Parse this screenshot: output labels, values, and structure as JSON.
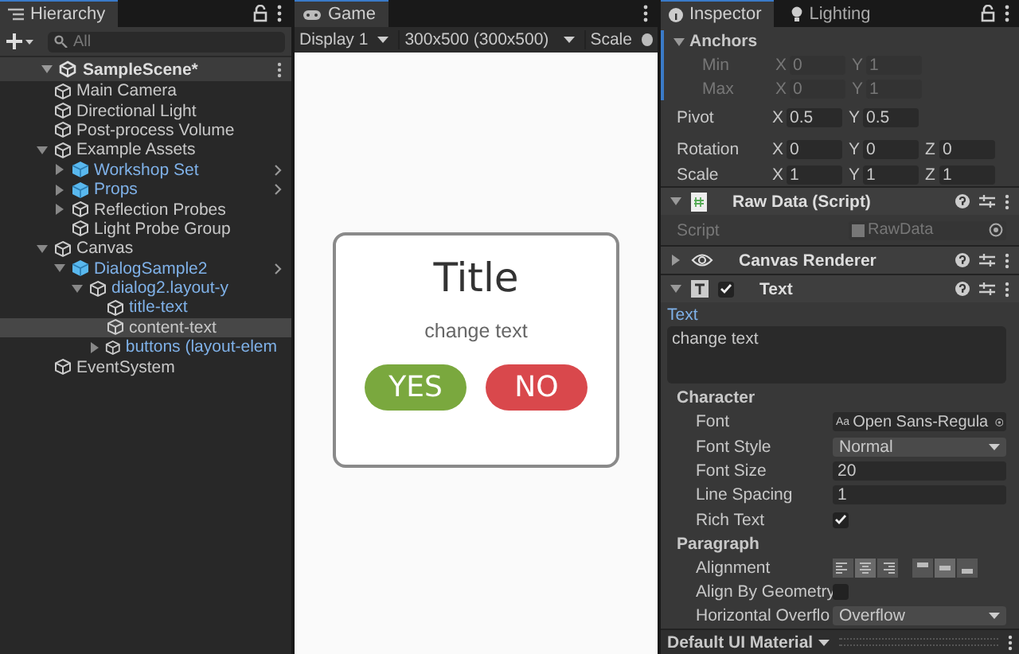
{
  "hierarchy": {
    "title": "Hierarchy",
    "search_placeholder": "All",
    "scene": {
      "name": "SampleScene*",
      "expanded": true
    },
    "items": [
      {
        "name": "Main Camera",
        "kind": "object",
        "selected": false
      },
      {
        "name": "Directional Light",
        "kind": "object",
        "selected": false
      },
      {
        "name": "Post-process Volume",
        "kind": "object",
        "selected": false
      },
      {
        "name": "Example Assets",
        "kind": "object",
        "selected": false,
        "expanded": true,
        "children": [
          {
            "name": "Workshop Set",
            "kind": "prefab",
            "selected": false,
            "expanded": false
          },
          {
            "name": "Props",
            "kind": "prefab",
            "selected": false,
            "expanded": false
          },
          {
            "name": "Reflection Probes",
            "kind": "object",
            "selected": false,
            "expanded": false
          },
          {
            "name": "Light Probe Group",
            "kind": "object",
            "selected": false
          }
        ]
      },
      {
        "name": "Canvas",
        "kind": "object",
        "selected": false,
        "expanded": true,
        "children": [
          {
            "name": "DialogSample2",
            "kind": "prefab",
            "selected": false,
            "expanded": true,
            "children": [
              {
                "name": "dialog2.layout-y",
                "kind": "prefab-child",
                "selected": false,
                "expanded": true,
                "children": [
                  {
                    "name": "title-text",
                    "kind": "prefab-child",
                    "selected": false
                  },
                  {
                    "name": "content-text",
                    "kind": "object",
                    "selected": true
                  },
                  {
                    "name": "buttons (layout-elem",
                    "kind": "prefab-child",
                    "selected": false,
                    "expanded": false
                  }
                ]
              }
            ]
          }
        ]
      },
      {
        "name": "EventSystem",
        "kind": "object",
        "selected": false
      }
    ]
  },
  "game": {
    "tab": "Game",
    "display": "Display 1",
    "resolution": "300x500 (300x500)",
    "scale": "Scale",
    "dialog": {
      "title": "Title",
      "text": "change text",
      "buttons": [
        {
          "label": "YES",
          "color": "#7aa83e"
        },
        {
          "label": "NO",
          "color": "#d9484c"
        }
      ]
    }
  },
  "inspector": {
    "tabs": [
      {
        "label": "Inspector",
        "selected": true
      },
      {
        "label": "Lighting",
        "selected": false
      }
    ],
    "anchors": {
      "label": "Anchors",
      "expanded": true
    },
    "transform_rows": [
      {
        "label": "Min",
        "kind": "sub",
        "disabled": true,
        "values": [
          {
            "axis": "X",
            "value": "0"
          },
          {
            "axis": "Y",
            "value": "1"
          }
        ]
      },
      {
        "label": "Max",
        "kind": "sub",
        "disabled": true,
        "values": [
          {
            "axis": "X",
            "value": "0"
          },
          {
            "axis": "Y",
            "value": "1"
          }
        ]
      },
      {
        "label": "Pivot",
        "kind": "main",
        "disabled": false,
        "values": [
          {
            "axis": "X",
            "value": "0.5"
          },
          {
            "axis": "Y",
            "value": "0.5"
          }
        ]
      },
      {
        "label": "Rotation",
        "kind": "main",
        "disabled": false,
        "values": [
          {
            "axis": "X",
            "value": "0"
          },
          {
            "axis": "Y",
            "value": "0"
          },
          {
            "axis": "Z",
            "value": "0"
          }
        ]
      },
      {
        "label": "Scale",
        "kind": "main",
        "disabled": false,
        "values": [
          {
            "axis": "X",
            "value": "1"
          },
          {
            "axis": "Y",
            "value": "1"
          },
          {
            "axis": "Z",
            "value": "1"
          }
        ]
      }
    ],
    "components": [
      {
        "name": "Raw Data (Script)",
        "kind": "script",
        "expanded": true,
        "fields": [
          {
            "kind": "object",
            "label": "Script",
            "value": "RawData",
            "disabled": true
          }
        ]
      },
      {
        "name": "Canvas Renderer",
        "kind": "renderer",
        "expanded": false
      },
      {
        "name": "Text",
        "kind": "text",
        "expanded": true,
        "enabled": true,
        "fields": [
          {
            "kind": "textarea",
            "label": "Text",
            "value": "change text"
          },
          {
            "kind": "header",
            "label": "Character"
          },
          {
            "kind": "object",
            "label": "Font",
            "prefix": "Aa",
            "value": "Open Sans-Regula",
            "disabled": false
          },
          {
            "kind": "dropdown",
            "label": "Font Style",
            "value": "Normal"
          },
          {
            "kind": "number",
            "label": "Font Size",
            "value": "20"
          },
          {
            "kind": "number",
            "label": "Line Spacing",
            "value": "1"
          },
          {
            "kind": "checkbox",
            "label": "Rich Text",
            "checked": true
          },
          {
            "kind": "header",
            "label": "Paragraph"
          },
          {
            "kind": "alignment",
            "label": "Alignment",
            "horizontal": [
              {
                "selected": false
              },
              {
                "selected": true
              },
              {
                "selected": false
              }
            ],
            "vertical": [
              {
                "selected": false
              },
              {
                "selected": true
              },
              {
                "selected": false
              }
            ]
          },
          {
            "kind": "checkbox",
            "label": "Align By Geometry",
            "checked": false
          },
          {
            "kind": "dropdown",
            "label": "Horizontal Overflo",
            "value": "Overflow"
          }
        ]
      }
    ],
    "material": "Default UI Material"
  }
}
